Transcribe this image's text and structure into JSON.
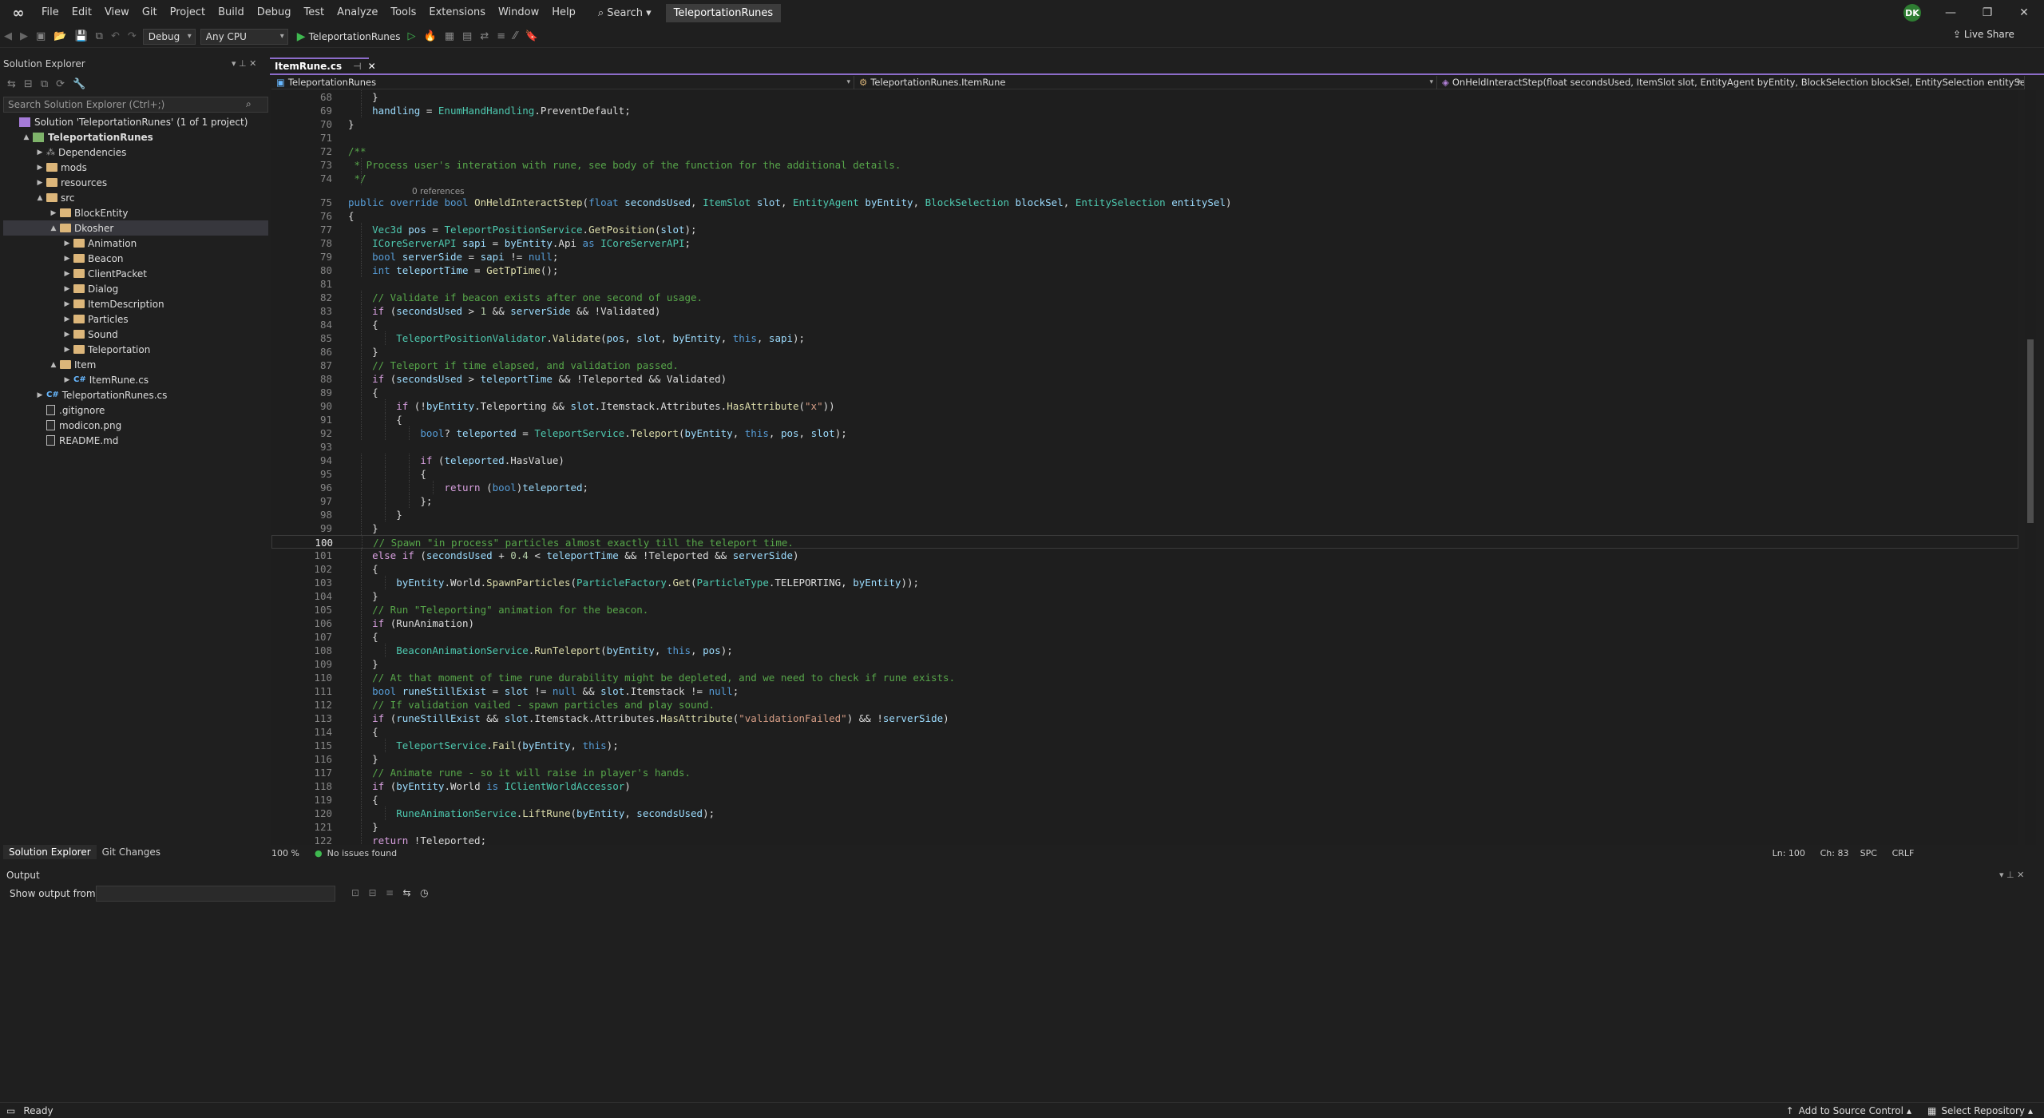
{
  "title_bar": {
    "menu": [
      "File",
      "Edit",
      "View",
      "Git",
      "Project",
      "Build",
      "Debug",
      "Test",
      "Analyze",
      "Tools",
      "Extensions",
      "Window",
      "Help"
    ],
    "search_label": "Search",
    "app_title": "TeleportationRunes",
    "avatar_initials": "DK"
  },
  "toolbar": {
    "configuration": "Debug",
    "platform": "Any CPU",
    "run_target": "TeleportationRunes",
    "live_share": "Live Share"
  },
  "solution_explorer": {
    "title": "Solution Explorer",
    "search_placeholder": "Search Solution Explorer (Ctrl+;)",
    "tree": [
      {
        "label": "Solution 'TeleportationRunes' (1 of 1 project)",
        "kind": "solution",
        "indent": 0,
        "arrow": ""
      },
      {
        "label": "TeleportationRunes",
        "kind": "project",
        "indent": 1,
        "arrow": "▲"
      },
      {
        "label": "Dependencies",
        "kind": "dependencies",
        "indent": 2,
        "arrow": "▶"
      },
      {
        "label": "mods",
        "kind": "folder",
        "indent": 2,
        "arrow": "▶"
      },
      {
        "label": "resources",
        "kind": "folder",
        "indent": 2,
        "arrow": "▶"
      },
      {
        "label": "src",
        "kind": "folder",
        "indent": 2,
        "arrow": "▲"
      },
      {
        "label": "BlockEntity",
        "kind": "folder",
        "indent": 3,
        "arrow": "▶"
      },
      {
        "label": "Dkosher",
        "kind": "folder",
        "indent": 3,
        "arrow": "▲",
        "selected": true
      },
      {
        "label": "Animation",
        "kind": "folder",
        "indent": 4,
        "arrow": "▶"
      },
      {
        "label": "Beacon",
        "kind": "folder",
        "indent": 4,
        "arrow": "▶"
      },
      {
        "label": "ClientPacket",
        "kind": "folder",
        "indent": 4,
        "arrow": "▶"
      },
      {
        "label": "Dialog",
        "kind": "folder",
        "indent": 4,
        "arrow": "▶"
      },
      {
        "label": "ItemDescription",
        "kind": "folder",
        "indent": 4,
        "arrow": "▶"
      },
      {
        "label": "Particles",
        "kind": "folder",
        "indent": 4,
        "arrow": "▶"
      },
      {
        "label": "Sound",
        "kind": "folder",
        "indent": 4,
        "arrow": "▶"
      },
      {
        "label": "Teleportation",
        "kind": "folder",
        "indent": 4,
        "arrow": "▶"
      },
      {
        "label": "Item",
        "kind": "folder",
        "indent": 3,
        "arrow": "▲"
      },
      {
        "label": "ItemRune.cs",
        "kind": "csharp",
        "indent": 4,
        "arrow": "▶"
      },
      {
        "label": "TeleportationRunes.cs",
        "kind": "csharp",
        "indent": 2,
        "arrow": "▶"
      },
      {
        "label": ".gitignore",
        "kind": "file",
        "indent": 2,
        "arrow": ""
      },
      {
        "label": "modicon.png",
        "kind": "file",
        "indent": 2,
        "arrow": ""
      },
      {
        "label": "README.md",
        "kind": "file",
        "indent": 2,
        "arrow": ""
      }
    ],
    "bottom_tabs": [
      "Solution Explorer",
      "Git Changes"
    ]
  },
  "editor": {
    "tab_label": "ItemRune.cs",
    "nav": {
      "project": "TeleportationRunes",
      "type": "TeleportationRunes.ItemRune",
      "member": "OnHeldInteractStep(float secondsUsed, ItemSlot slot, EntityAgent byEntity, BlockSelection blockSel, EntitySelection entitySel)"
    },
    "references_label": "0 references",
    "current_line": 100,
    "lines": [
      {
        "n": 68,
        "code": "    }"
      },
      {
        "n": 69,
        "code": "    handling = EnumHandHandling.PreventDefault;"
      },
      {
        "n": 70,
        "code": "}"
      },
      {
        "n": 71,
        "code": ""
      },
      {
        "n": 72,
        "code": "/**"
      },
      {
        "n": 73,
        "code": " * Process user's interation with rune, see body of the function for the additional details."
      },
      {
        "n": 74,
        "code": " */"
      },
      {
        "n": 75,
        "code": "public override bool OnHeldInteractStep(float secondsUsed, ItemSlot slot, EntityAgent byEntity, BlockSelection blockSel, EntitySelection entitySel)"
      },
      {
        "n": 76,
        "code": "{"
      },
      {
        "n": 77,
        "code": "    Vec3d pos = TeleportPositionService.GetPosition(slot);"
      },
      {
        "n": 78,
        "code": "    ICoreServerAPI sapi = byEntity.Api as ICoreServerAPI;"
      },
      {
        "n": 79,
        "code": "    bool serverSide = sapi != null;"
      },
      {
        "n": 80,
        "code": "    int teleportTime = GetTpTime();"
      },
      {
        "n": 81,
        "code": ""
      },
      {
        "n": 82,
        "code": "    // Validate if beacon exists after one second of usage."
      },
      {
        "n": 83,
        "code": "    if (secondsUsed > 1 && serverSide && !Validated)"
      },
      {
        "n": 84,
        "code": "    {"
      },
      {
        "n": 85,
        "code": "        TeleportPositionValidator.Validate(pos, slot, byEntity, this, sapi);"
      },
      {
        "n": 86,
        "code": "    }"
      },
      {
        "n": 87,
        "code": "    // Teleport if time elapsed, and validation passed."
      },
      {
        "n": 88,
        "code": "    if (secondsUsed > teleportTime && !Teleported && Validated)"
      },
      {
        "n": 89,
        "code": "    {"
      },
      {
        "n": 90,
        "code": "        if (!byEntity.Teleporting && slot.Itemstack.Attributes.HasAttribute(\"x\"))"
      },
      {
        "n": 91,
        "code": "        {"
      },
      {
        "n": 92,
        "code": "            bool? teleported = TeleportService.Teleport(byEntity, this, pos, slot);"
      },
      {
        "n": 93,
        "code": ""
      },
      {
        "n": 94,
        "code": "            if (teleported.HasValue)"
      },
      {
        "n": 95,
        "code": "            {"
      },
      {
        "n": 96,
        "code": "                return (bool)teleported;"
      },
      {
        "n": 97,
        "code": "            };"
      },
      {
        "n": 98,
        "code": "        }"
      },
      {
        "n": 99,
        "code": "    }"
      },
      {
        "n": 100,
        "code": "    // Spawn \"in process\" particles almost exactly till the teleport time."
      },
      {
        "n": 101,
        "code": "    else if (secondsUsed + 0.4 < teleportTime && !Teleported && serverSide)"
      },
      {
        "n": 102,
        "code": "    {"
      },
      {
        "n": 103,
        "code": "        byEntity.World.SpawnParticles(ParticleFactory.Get(ParticleType.TELEPORTING, byEntity));"
      },
      {
        "n": 104,
        "code": "    }"
      },
      {
        "n": 105,
        "code": "    // Run \"Teleporting\" animation for the beacon."
      },
      {
        "n": 106,
        "code": "    if (RunAnimation)"
      },
      {
        "n": 107,
        "code": "    {"
      },
      {
        "n": 108,
        "code": "        BeaconAnimationService.RunTeleport(byEntity, this, pos);"
      },
      {
        "n": 109,
        "code": "    }"
      },
      {
        "n": 110,
        "code": "    // At that moment of time rune durability might be depleted, and we need to check if rune exists."
      },
      {
        "n": 111,
        "code": "    bool runeStillExist = slot != null && slot.Itemstack != null;"
      },
      {
        "n": 112,
        "code": "    // If validation vailed - spawn particles and play sound."
      },
      {
        "n": 113,
        "code": "    if (runeStillExist && slot.Itemstack.Attributes.HasAttribute(\"validationFailed\") && !serverSide)"
      },
      {
        "n": 114,
        "code": "    {"
      },
      {
        "n": 115,
        "code": "        TeleportService.Fail(byEntity, this);"
      },
      {
        "n": 116,
        "code": "    }"
      },
      {
        "n": 117,
        "code": "    // Animate rune - so it will raise in player's hands."
      },
      {
        "n": 118,
        "code": "    if (byEntity.World is IClientWorldAccessor)"
      },
      {
        "n": 119,
        "code": "    {"
      },
      {
        "n": 120,
        "code": "        RuneAnimationService.LiftRune(byEntity, secondsUsed);"
      },
      {
        "n": 121,
        "code": "    }"
      },
      {
        "n": 122,
        "code": "    return !Teleported;"
      }
    ]
  },
  "editor_status": {
    "zoom": "100 %",
    "issues": "No issues found",
    "line": "Ln: 100",
    "char": "Ch: 83",
    "whitespace": "SPC",
    "line_ending": "CRLF"
  },
  "output": {
    "title": "Output",
    "show_from_label": "Show output from:"
  },
  "status_bar": {
    "ready": "Ready",
    "source_control": "Add to Source Control",
    "repository": "Select Repository"
  },
  "colors": {
    "accent": "#8c6cc9",
    "keyword": "#569cd6",
    "control": "#d8a0df",
    "type": "#4ec9b0",
    "method": "#dcdcaa",
    "variable": "#9cdcfe",
    "comment": "#57a64a",
    "string": "#d69d85",
    "number": "#b5cea8",
    "ok": "#3fb950"
  }
}
